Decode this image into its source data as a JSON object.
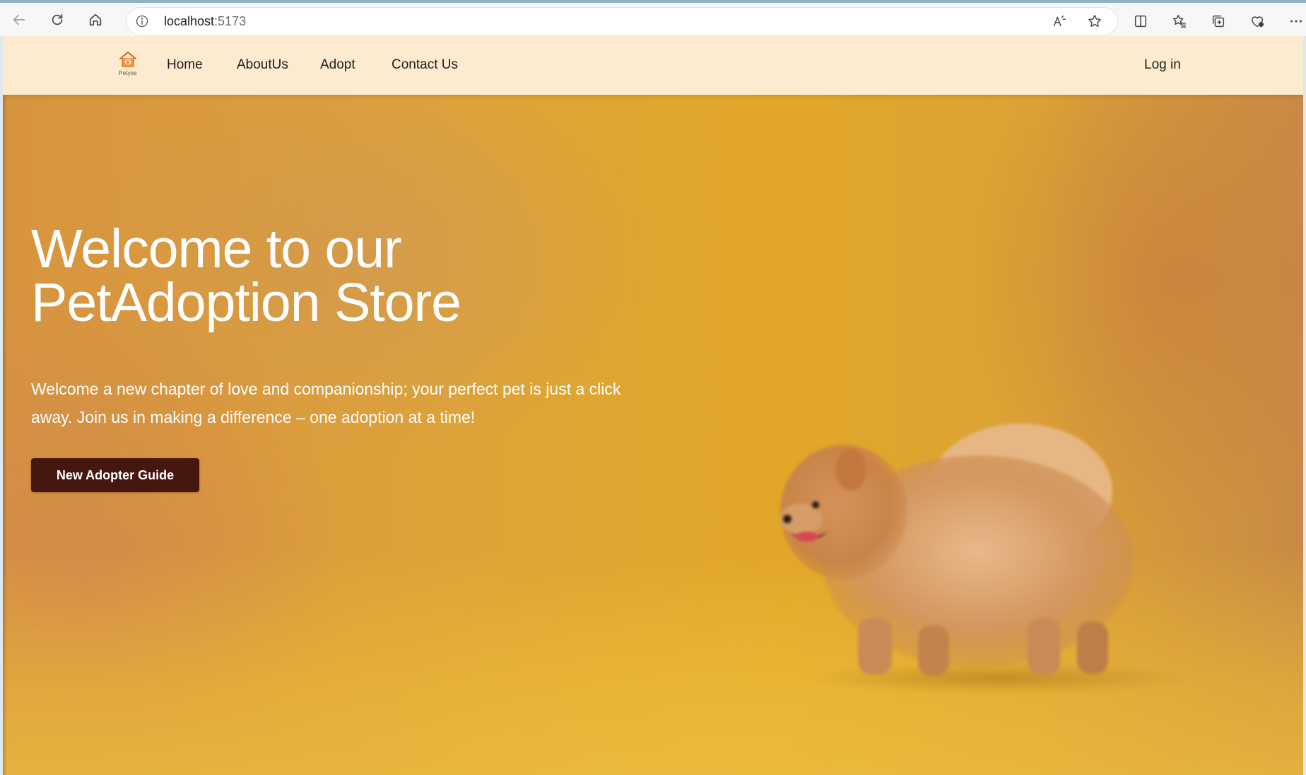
{
  "browser": {
    "address_host": "localhost",
    "address_port": ":5173"
  },
  "nav": {
    "brand_text": "Petyes",
    "links": [
      "Home",
      "AboutUs",
      "Adopt",
      "Contact Us"
    ],
    "login": "Log in"
  },
  "hero": {
    "title_line1": "Welcome to our",
    "title_line2": "PetAdoption Store",
    "subtitle_line1": "Welcome a new chapter of love and companionship; your perfect pet is just a click",
    "subtitle_line2": "away. Join us in making a difference – one adoption at a time!",
    "cta_label": "New Adopter Guide"
  },
  "colors": {
    "navbar_bg": "#fdebd0",
    "hero_bg": "#e2a728",
    "cta_bg": "#46170f",
    "text_light": "#ffffff"
  }
}
